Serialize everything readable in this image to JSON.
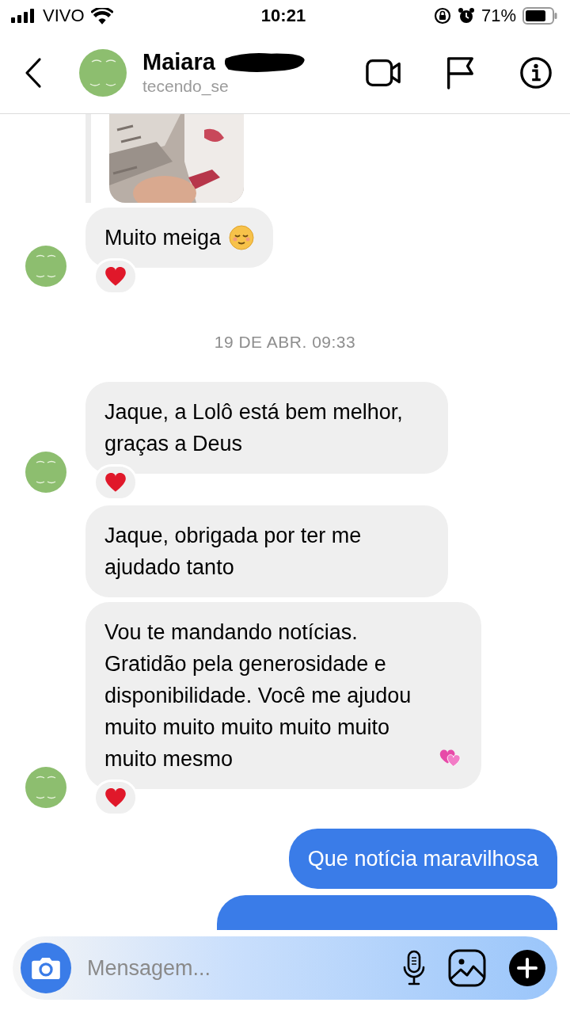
{
  "status_bar": {
    "carrier": "VIVO",
    "time": "10:21",
    "battery": "71%"
  },
  "header": {
    "name": "Maiara",
    "username": "tecendo_se"
  },
  "messages": [
    {
      "kind": "received_image"
    },
    {
      "kind": "received_text",
      "text": "Muito meiga",
      "emoji": {
        "kind": "relieved"
      },
      "avatar": true,
      "reaction": true
    },
    {
      "kind": "date",
      "text": "19 DE ABR. 09:33"
    },
    {
      "kind": "received_text",
      "text": "Jaque, a Lolô está bem melhor, graças a Deus",
      "avatar": true,
      "reaction": true
    },
    {
      "kind": "received_text",
      "text": "Jaque, obrigada por ter me ajudado tanto",
      "avatar": false,
      "reaction": false
    },
    {
      "kind": "received_text",
      "text": "Vou te mandando notícias. Gratidão pela generosidade e disponibilidade. Você me ajudou muito muito muito muito muito muito mesmo",
      "emoji": {
        "kind": "hearts"
      },
      "avatar": true,
      "reaction": true
    },
    {
      "kind": "sent_text",
      "text": "Que notícia maravilhosa"
    },
    {
      "kind": "sent_hidden"
    }
  ],
  "composer": {
    "placeholder": "Mensagem..."
  }
}
